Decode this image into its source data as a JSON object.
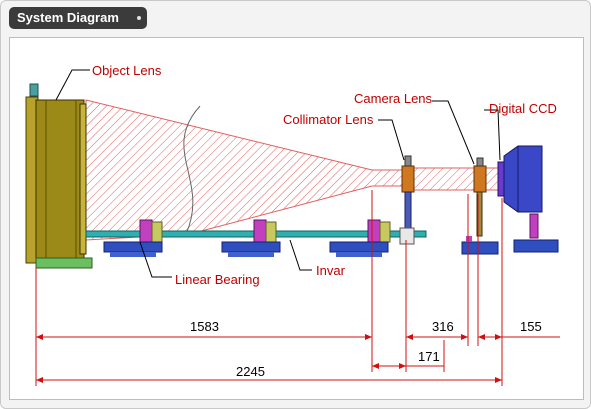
{
  "panel": {
    "title": "System Diagram"
  },
  "labels": {
    "object_lens": "Object Lens",
    "camera_lens": "Camera Lens",
    "digital_ccd": "Digital CCD",
    "collimator_lens": "Collimator Lens",
    "linear_bearing": "Linear Bearing",
    "invar": "Invar"
  },
  "dimensions": {
    "d1": "1583",
    "d2": "316",
    "d3": "155",
    "d4": "171",
    "d5": "2245"
  },
  "colors": {
    "label_red": "#c00000",
    "ray_hatch": "#e06060",
    "lens_olive": "#8a7a12",
    "rail_teal": "#20a0a0",
    "mount_blue": "#2f4fbf",
    "mount_magenta": "#c040c0",
    "ccd_blue": "#3a48c8",
    "dim_line": "#d01010"
  }
}
